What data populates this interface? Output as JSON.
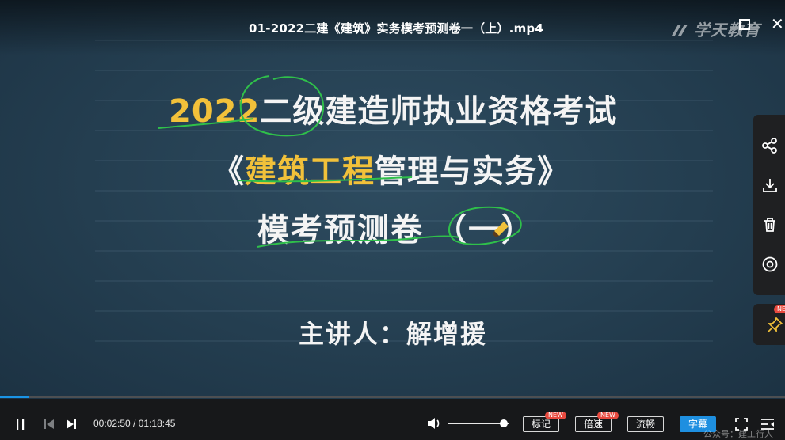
{
  "window": {
    "file_title": "01-2022二建《建筑》实务模考预测卷一（上）.mp4",
    "watermark_logo": "学天教育"
  },
  "slide": {
    "line1_year": "2022",
    "line1_rest": "二级建造师执业资格考试",
    "line2_open": "《",
    "line2_yellow": "建筑工程",
    "line2_rest": "管理与实务》",
    "line3_text": "模考预测卷",
    "line3_paren": "（一）",
    "line4_text": "主讲人：解增援"
  },
  "side_panel": {
    "icons": [
      "share-icon",
      "download-icon",
      "trash-icon",
      "eye-icon"
    ],
    "pin_icon": "pin-icon",
    "pin_badge": "NEW"
  },
  "controls": {
    "current_time": "00:02:50",
    "separator": " / ",
    "total_time": "01:18:45",
    "progress_fraction": 0.036,
    "volume_fraction": 0.92,
    "mark_label": "标记",
    "mark_badge": "NEW",
    "speed_label": "倍速",
    "speed_badge": "NEW",
    "quality_label": "流畅",
    "subtitle_label": "字幕",
    "accent_color": "#1e8fe0",
    "badge_color": "#e84a3f"
  },
  "footer_watermark": "公众号：建工行人"
}
